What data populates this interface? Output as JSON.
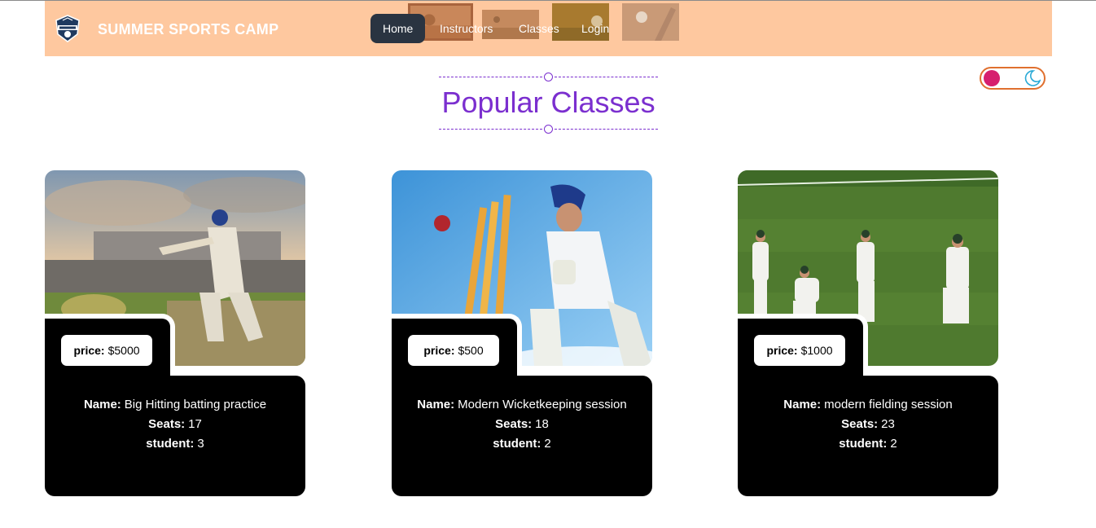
{
  "brand": {
    "name": "SUMMER SPORTS CAMP"
  },
  "nav": {
    "items": [
      {
        "label": "Home"
      },
      {
        "label": "Instructors"
      },
      {
        "label": "Classes"
      },
      {
        "label": "Login"
      }
    ]
  },
  "section": {
    "title": "Popular Classes"
  },
  "theme_toggle": {
    "icon": "moon-icon",
    "knob_color": "#d61f6e"
  },
  "labels": {
    "price": "price:",
    "name": "Name:",
    "seats": "Seats:",
    "student": "student:"
  },
  "classes": [
    {
      "name": "Big Hitting batting practice",
      "price": "$5000",
      "seats": "17",
      "students": "3"
    },
    {
      "name": "Modern Wicketkeeping session",
      "price": "$500",
      "seats": "18",
      "students": "2"
    },
    {
      "name": "modern fielding session",
      "price": "$1000",
      "seats": "23",
      "students": "2"
    }
  ],
  "colors": {
    "navbar": "#fec89f",
    "accent": "#7b2fcf",
    "active_nav": "#2a3441"
  }
}
